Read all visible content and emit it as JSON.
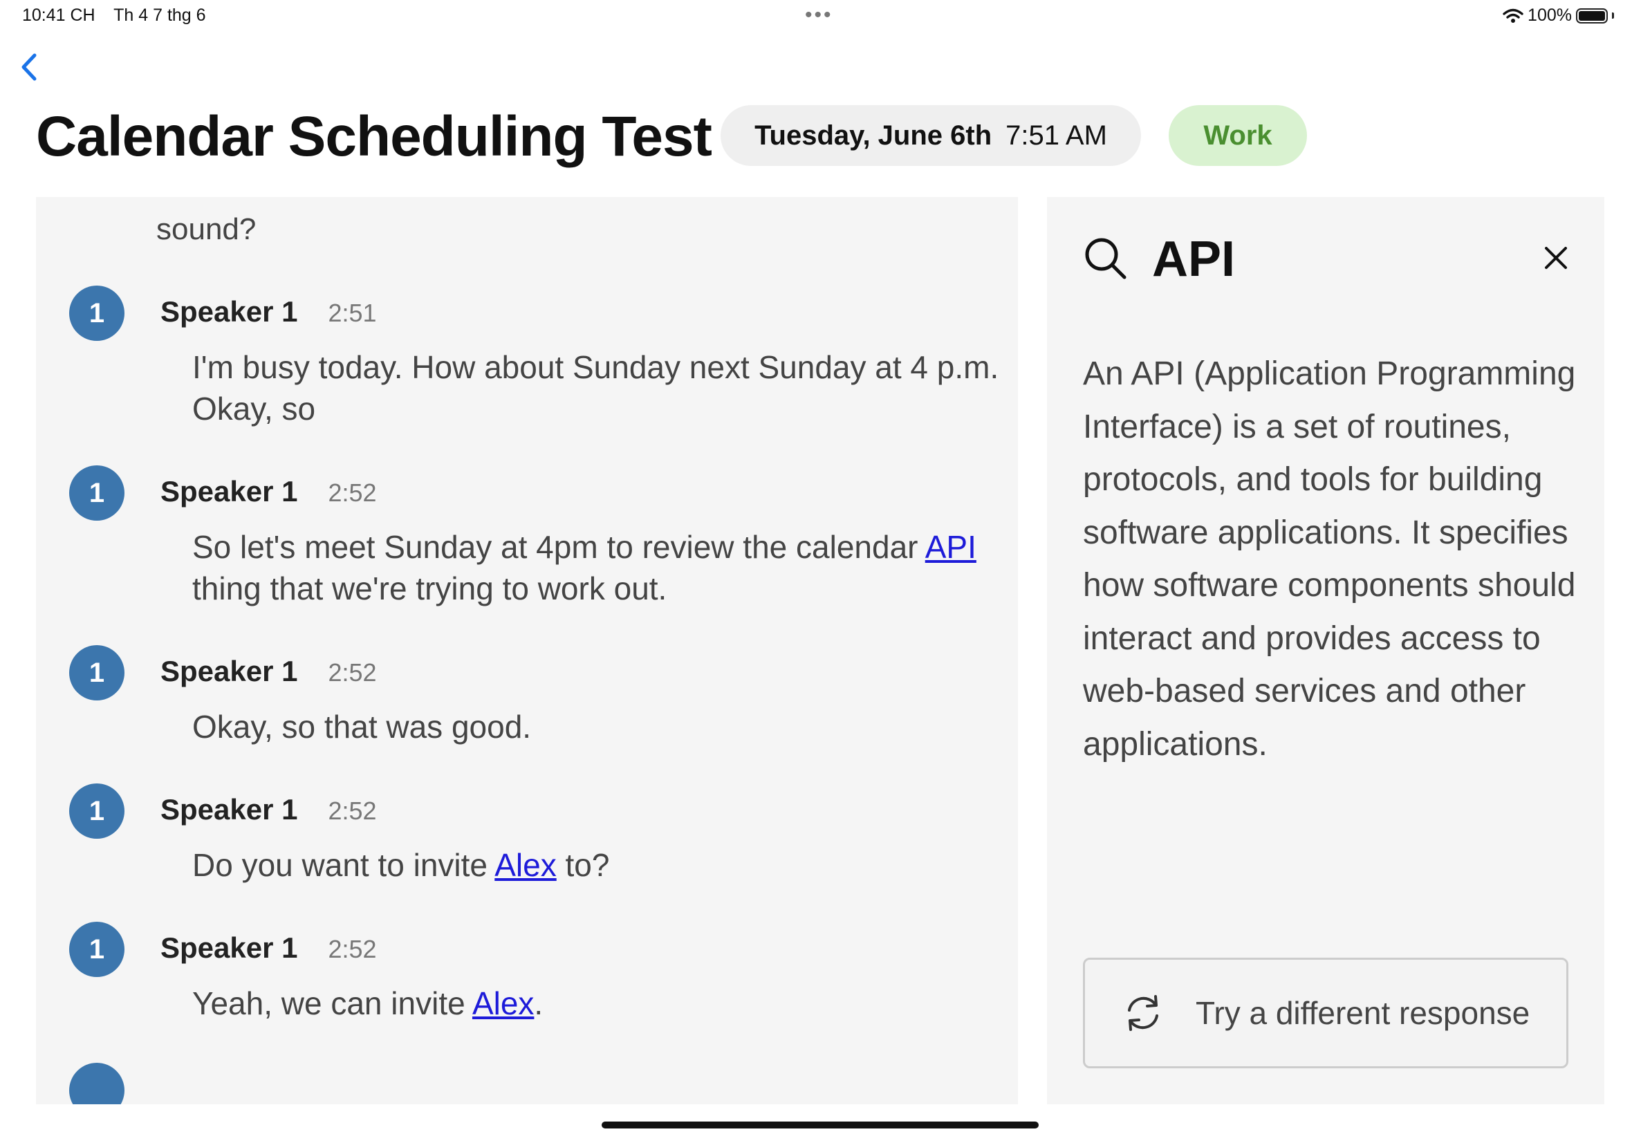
{
  "status_bar": {
    "time": "10:41 CH",
    "date": "Th 4 7 thg 6",
    "battery": "100%"
  },
  "header": {
    "title": "Calendar Scheduling Test",
    "date": "Tuesday, June 6th",
    "time": "7:51 AM",
    "tag": "Work"
  },
  "transcript": {
    "fragment": "sound?",
    "messages": [
      {
        "avatar": "1",
        "speaker": "Speaker 1",
        "time": "2:51",
        "text_before": "I'm busy today. How about Sunday next Sunday at 4 p.m. Okay, so"
      },
      {
        "avatar": "1",
        "speaker": "Speaker 1",
        "time": "2:52",
        "text_before": "So let's meet Sunday at 4pm to review the calendar ",
        "link": "API",
        "text_after": " thing that we're trying to work out."
      },
      {
        "avatar": "1",
        "speaker": "Speaker 1",
        "time": "2:52",
        "text_before": "Okay, so that was good."
      },
      {
        "avatar": "1",
        "speaker": "Speaker 1",
        "time": "2:52",
        "text_before": "Do you want to invite ",
        "link": "Alex",
        "text_after": " to?"
      },
      {
        "avatar": "1",
        "speaker": "Speaker 1",
        "time": "2:52",
        "text_before": "Yeah, we can invite ",
        "link": "Alex",
        "text_after": "."
      }
    ]
  },
  "definition_panel": {
    "term": "API",
    "definition": "An API (Application Programming Interface) is a set of routines, protocols, and tools for building software applications. It specifies how software components should interact and provides access to web-based services and other applications.",
    "retry_label": "Try a different response"
  },
  "colors": {
    "avatar": "#3c76ad",
    "link": "#1d1bd9",
    "tag_bg": "#d9f2d0",
    "tag_text": "#4a8f30",
    "accent": "#1a73e8"
  },
  "icons": [
    "chevron-left-icon",
    "search-icon",
    "close-icon",
    "refresh-icon",
    "wifi-icon",
    "battery-icon"
  ]
}
